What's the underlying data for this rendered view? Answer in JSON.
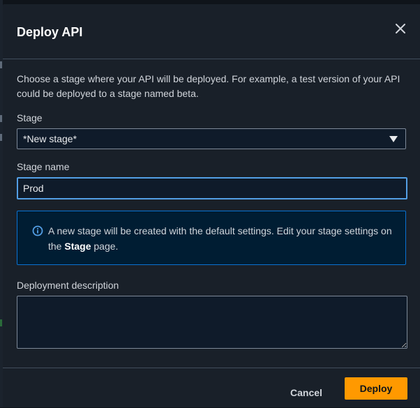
{
  "dialog": {
    "title": "Deploy API",
    "intro": "Choose a stage where your API will be deployed. For example, a test version of your API could be deployed to a stage named beta."
  },
  "stage": {
    "label": "Stage",
    "selected": "*New stage*"
  },
  "stage_name": {
    "label": "Stage name",
    "value": "Prod"
  },
  "alert": {
    "text_before": "A new stage will be created with the default settings. Edit your stage settings on the",
    "link_text": "Stage",
    "text_after": "page."
  },
  "description": {
    "label": "Deployment description",
    "value": ""
  },
  "footer": {
    "cancel_label": "Cancel",
    "deploy_label": "Deploy"
  },
  "colors": {
    "primary_button": "#ff9900",
    "focus_border": "#539fe5",
    "info_border": "#0972d3"
  },
  "icons": {
    "close": "close-icon",
    "dropdown": "caret-down-icon",
    "info": "info-icon"
  }
}
